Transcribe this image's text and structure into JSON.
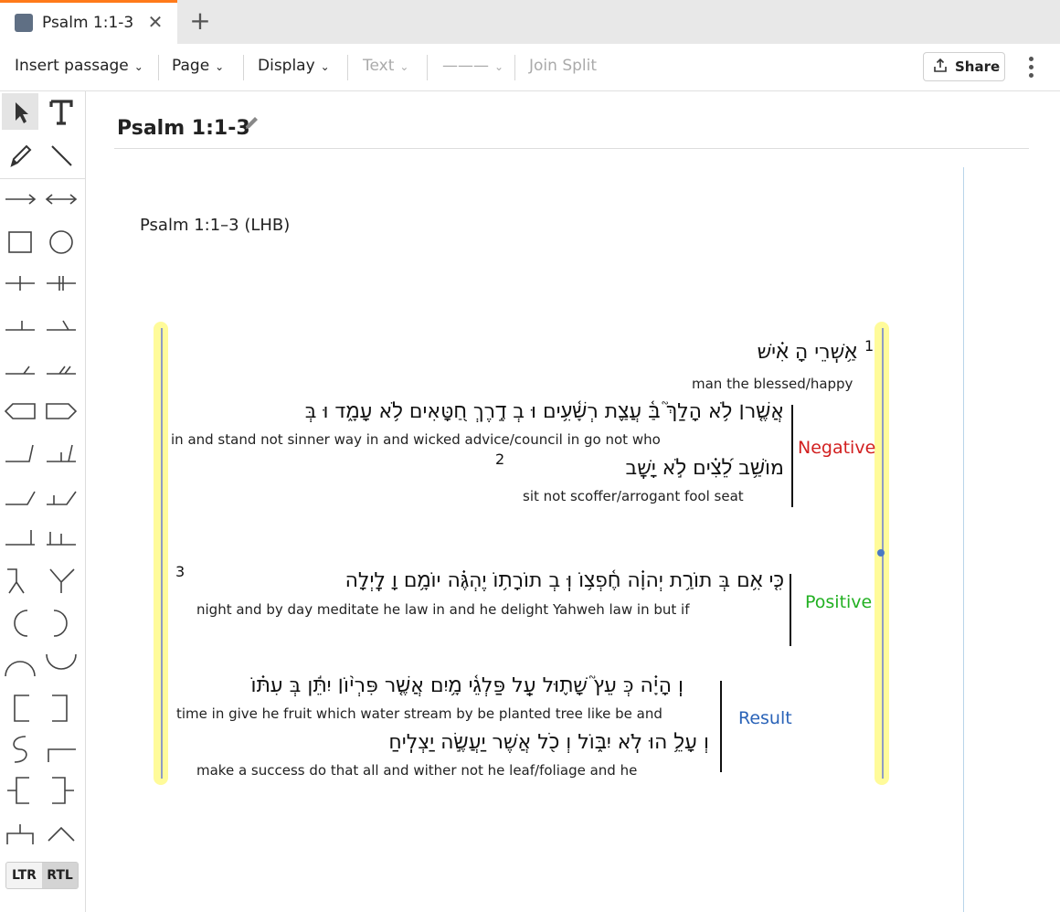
{
  "tab": {
    "title": "Psalm 1:1-3",
    "close": "✕",
    "add": "+"
  },
  "toolbar": {
    "insert_passage": "Insert passage",
    "page": "Page",
    "display": "Display",
    "text": "Text",
    "line_style": "———",
    "join_split": "Join Split",
    "share": "Share",
    "chevron": "⌄"
  },
  "palette": {
    "ltr": "LTR",
    "rtl": "RTL"
  },
  "document": {
    "title": "Psalm 1:1-3",
    "passage_ref": "Psalm 1:1–3 (LHB)",
    "lines": [
      {
        "verse": "1",
        "hebrew": "אַ֥שְֽׁרֵי   הָ   אִ֗ישׁ",
        "gloss": "man  the  blessed/happy"
      },
      {
        "verse": "",
        "hebrew": "אֲשֶׁ֤ר׀ לֹ֥א הָלַךְ֮ בַּ֫   עֲצַ֪ת   רְשָׁ֫עִ֥ים  וּ  בְ דֶ֣רֶךְ חַ֭טָּאִים לֹ֥א עָמָ֑ד  וּ  בְּ",
        "gloss": "in  and  stand   not    sinner     way   in  and   wicked   advice/council  in    go    not    who"
      },
      {
        "verse": "2",
        "hebrew": "מוֹשַׁ֥ב       לֵ֝צִ֗ים       לֹ֣א יָשָֽׁב",
        "gloss": "sit    not   scoffer/arrogant fool    seat"
      },
      {
        "verse": "3",
        "hebrew": "כִּ֤י אִ֥ם בְּ תוֹרַ֥ת יְהוָ֗ה חֶ֫פְצ֥וֹ  וּֽ  בְ תוֹרָת֥וֹ  יֶהְגֶּ֗ה יוֹמָ֥ם  וָ  לָֽיְלָה",
        "gloss": "night   and  by day  meditate  he     law     in  and  he  delight  Yahweh      law      in     but if"
      },
      {
        "verse": "",
        "hebrew": "וְֽ  הָיָ֗ה  כְּ עֵץ֮  שָׁת֪וּל  עַֽל פַּלְגֵ֫י מָ֥יִם אֲשֶׁ֤ר פִּרְי֨וֹ׀ יִתֵּ֬ן בְּ עִתּ֗וֹ",
        "gloss": "time  in  give  he  fruit   which  water  stream   by   be planted  tree  like     be     and"
      },
      {
        "verse": "",
        "hebrew": "וְ  עָלֵ֥  הוּ לֹֽא יִבּ֑וֹל  וְ כֹ֖ל אֲשֶׁר יַעֲשֶׂ֣ה  יַצְלִֽיחַ",
        "gloss": "make a success     do       that     all    and  wither  not    he   leaf/foliage  and   he"
      }
    ],
    "labels": {
      "negative": "Negative",
      "positive": "Positive",
      "result": "Result"
    }
  },
  "colors": {
    "tab_accent": "#ff7a1a",
    "highlight": "#fffb9a",
    "negative": "#d21f1f",
    "positive": "#22b022",
    "result": "#2a63b8"
  },
  "icons": [
    "tab-icon",
    "close-icon",
    "plus-icon",
    "share-icon",
    "more-icon",
    "edit-icon",
    "select-arrow-icon",
    "text-tool-icon",
    "pencil-icon",
    "line-icon"
  ]
}
